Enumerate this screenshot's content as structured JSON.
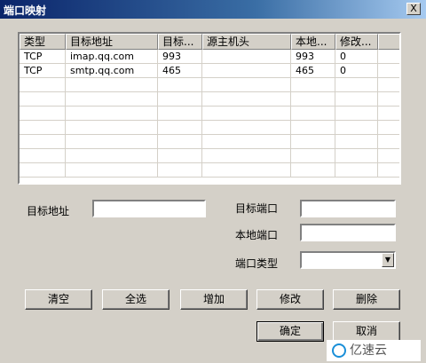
{
  "window": {
    "title": "端口映射",
    "close_label": "X"
  },
  "table": {
    "columns": [
      "类型",
      "目标地址",
      "目标...",
      "源主机头",
      "本地...",
      "修改...",
      ""
    ],
    "rows": [
      [
        "TCP",
        "imap.qq.com",
        "993",
        "",
        "993",
        "0",
        ""
      ],
      [
        "TCP",
        "smtp.qq.com",
        "465",
        "",
        "465",
        "0",
        ""
      ]
    ],
    "empty_rows": 7
  },
  "form": {
    "target_address_label": "目标地址",
    "target_address_value": "",
    "target_port_label": "目标端口",
    "target_port_value": "",
    "local_port_label": "本地端口",
    "local_port_value": "",
    "port_type_label": "端口类型",
    "port_type_value": ""
  },
  "buttons": {
    "clear": "清空",
    "select_all": "全选",
    "add": "增加",
    "modify": "修改",
    "delete": "删除",
    "ok": "确定",
    "cancel": "取消"
  },
  "watermark": {
    "text": "亿速云"
  }
}
